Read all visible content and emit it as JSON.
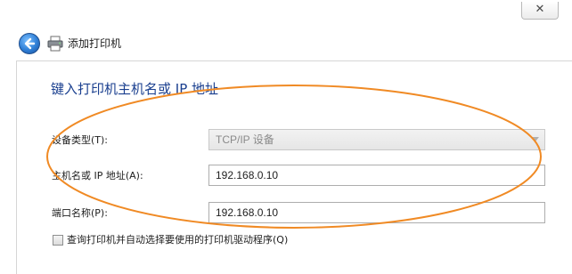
{
  "window": {
    "close_glyph": "✕"
  },
  "nav": {
    "title": "添加打印机"
  },
  "form": {
    "heading": "键入打印机主机名或 IP 地址",
    "device_type": {
      "label": "设备类型(T):",
      "value": "TCP/IP 设备"
    },
    "hostname": {
      "label": "主机名或 IP 地址(A):",
      "value": "192.168.0.10"
    },
    "port_name": {
      "label": "端口名称(P):",
      "value": "192.168.0.10"
    },
    "query_driver": {
      "label": "查询打印机并自动选择要使用的打印机驱动程序(Q)",
      "checked": false
    }
  },
  "colors": {
    "heading": "#1a3f8f",
    "annotation_ellipse": "#f08a24",
    "back_button": "#2f7fd6"
  },
  "icons": [
    "close-icon",
    "back-arrow-icon",
    "printer-icon",
    "dropdown-arrow-icon"
  ]
}
